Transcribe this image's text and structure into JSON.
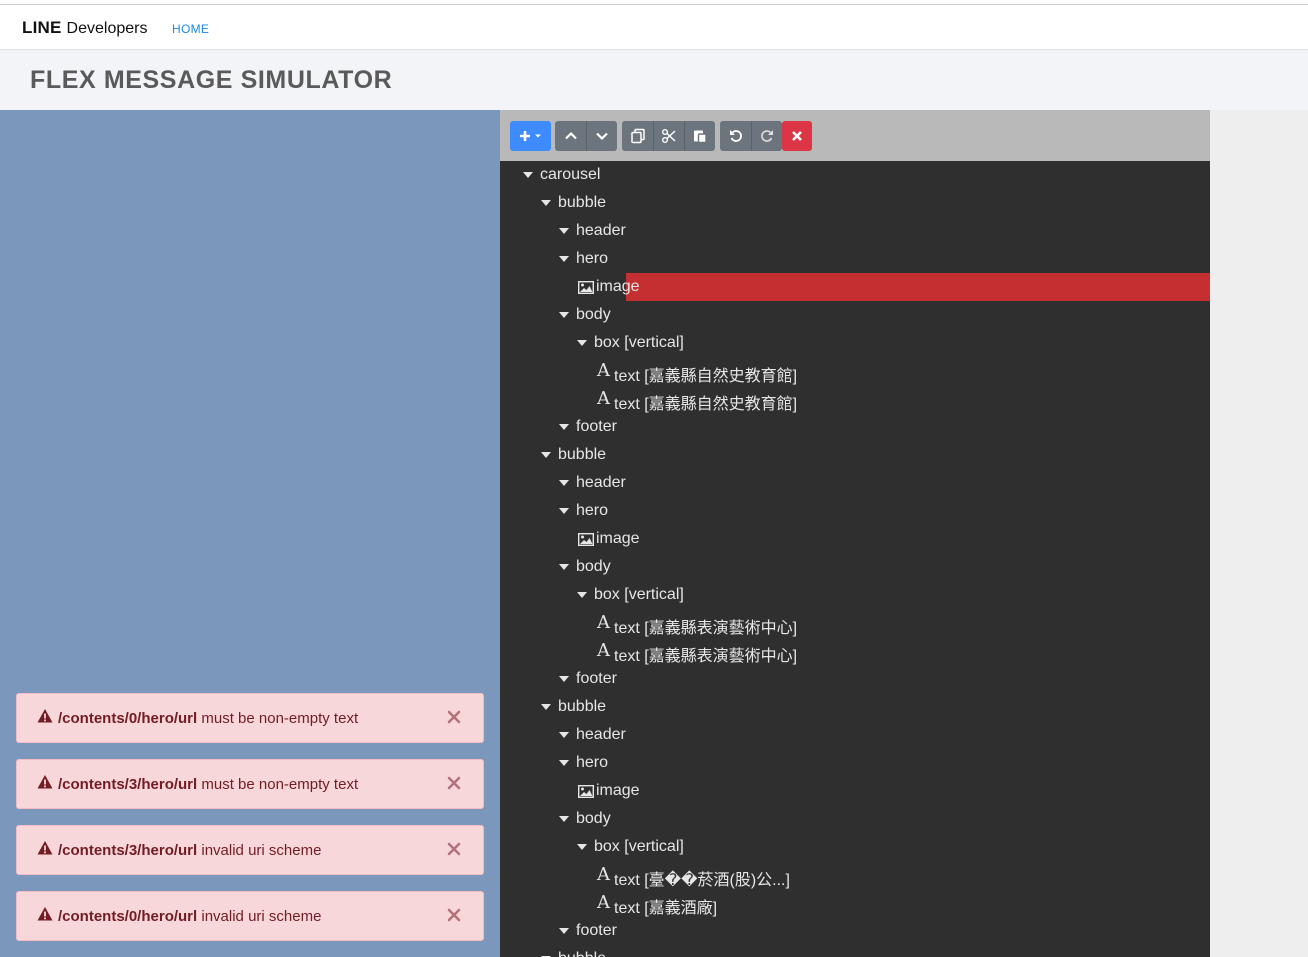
{
  "nav": {
    "brand_line": "LINE",
    "brand_rest": "Developers",
    "home": "HOME"
  },
  "page": {
    "title": "FLEX MESSAGE SIMULATOR"
  },
  "alerts": [
    {
      "path": "/contents/0/hero/url",
      "message": "must be non-empty text"
    },
    {
      "path": "/contents/3/hero/url",
      "message": "must be non-empty text"
    },
    {
      "path": "/contents/3/hero/url",
      "message": "invalid uri scheme"
    },
    {
      "path": "/contents/0/hero/url",
      "message": "invalid uri scheme"
    }
  ],
  "toolbar": {
    "icons": [
      "plus-icon",
      "chevron-down-icon",
      "chevron-up-icon",
      "chevron-down-icon",
      "copy-icon",
      "scissors-icon",
      "paste-icon",
      "undo-icon",
      "redo-icon",
      "close-icon"
    ]
  },
  "tree": [
    {
      "label": "carousel",
      "type": "node"
    },
    {
      "label": "bubble",
      "type": "node"
    },
    {
      "label": "header",
      "type": "node"
    },
    {
      "label": "hero",
      "type": "node"
    },
    {
      "label": "image",
      "type": "image",
      "selected": true
    },
    {
      "label": "body",
      "type": "node"
    },
    {
      "label": "box [vertical]",
      "type": "node"
    },
    {
      "label": "text [嘉義縣自然史教育館]",
      "type": "text"
    },
    {
      "label": "text [嘉義縣自然史教育館]",
      "type": "text"
    },
    {
      "label": "footer",
      "type": "node"
    },
    {
      "label": "bubble",
      "type": "node"
    },
    {
      "label": "header",
      "type": "node"
    },
    {
      "label": "hero",
      "type": "node"
    },
    {
      "label": "image",
      "type": "image"
    },
    {
      "label": "body",
      "type": "node"
    },
    {
      "label": "box [vertical]",
      "type": "node"
    },
    {
      "label": "text [嘉義縣表演藝術中心]",
      "type": "text"
    },
    {
      "label": "text [嘉義縣表演藝術中心]",
      "type": "text"
    },
    {
      "label": "footer",
      "type": "node"
    },
    {
      "label": "bubble",
      "type": "node"
    },
    {
      "label": "header",
      "type": "node"
    },
    {
      "label": "hero",
      "type": "node"
    },
    {
      "label": "image",
      "type": "image"
    },
    {
      "label": "body",
      "type": "node"
    },
    {
      "label": "box [vertical]",
      "type": "node"
    },
    {
      "label": "text [臺��菸酒(股)公...]",
      "type": "text"
    },
    {
      "label": "text [嘉義酒廠]",
      "type": "text"
    },
    {
      "label": "footer",
      "type": "node"
    },
    {
      "label": "bubble",
      "type": "node"
    }
  ],
  "colors": {
    "selected": "#c62f32",
    "preview_bg": "#7b97bc",
    "editor_bg": "#2f2f2f",
    "alert_bg": "#f8d7da",
    "alert_text": "#721c24"
  }
}
